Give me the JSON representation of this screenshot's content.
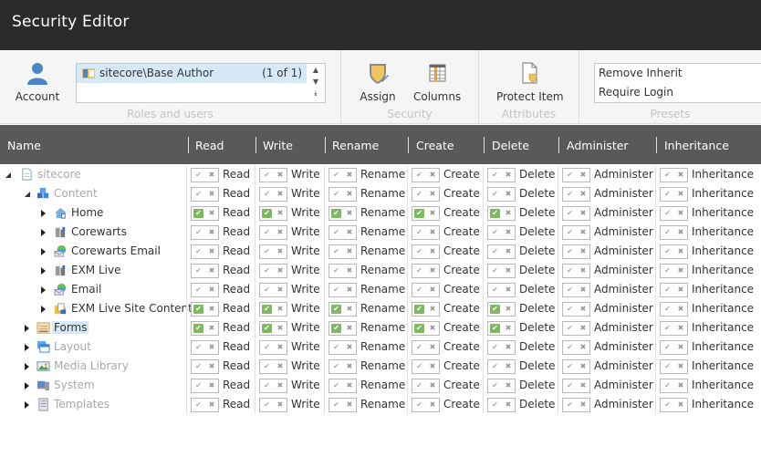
{
  "window": {
    "title": "Security Editor"
  },
  "ribbon": {
    "roles_group": {
      "label": "Roles and users",
      "account_button": "Account",
      "selected_role": "sitecore\\Base Author",
      "role_count": "(1 of 1)",
      "scroll_up": "▲",
      "scroll_down": "▼",
      "scroll_more": "⯯"
    },
    "security_group": {
      "label": "Security",
      "assign_button": "Assign",
      "columns_button": "Columns"
    },
    "attributes_group": {
      "label": "Attributes",
      "protect_button": "Protect Item"
    },
    "presets_group": {
      "label": "Presets",
      "items": [
        "Remove Inherit",
        "Require Login"
      ]
    }
  },
  "grid": {
    "columns": [
      "Name",
      "Read",
      "Write",
      "Rename",
      "Create",
      "Delete",
      "Administer",
      "Inheritance"
    ],
    "perm_labels": [
      "Read",
      "Write",
      "Rename",
      "Create",
      "Delete",
      "Administer",
      "Inheritance"
    ],
    "allow_glyph": "✔",
    "deny_glyph": "✖",
    "rows": [
      {
        "name": "sitecore",
        "icon": "document-icon",
        "level": 0,
        "state": "expanded",
        "style": "dim",
        "allow": [
          false,
          false,
          false,
          false,
          false,
          false,
          false
        ]
      },
      {
        "name": "Content",
        "icon": "content-cubes-icon",
        "level": 1,
        "state": "expanded",
        "style": "dim",
        "allow": [
          false,
          false,
          false,
          false,
          false,
          false,
          false
        ]
      },
      {
        "name": "Home",
        "icon": "home-icon",
        "level": 2,
        "state": "collapsed",
        "style": "norm",
        "allow": [
          true,
          true,
          true,
          true,
          true,
          false,
          false
        ]
      },
      {
        "name": "Corewarts",
        "icon": "server-icon",
        "level": 2,
        "state": "collapsed",
        "style": "norm",
        "allow": [
          false,
          false,
          false,
          false,
          false,
          false,
          false
        ]
      },
      {
        "name": "Corewarts Email",
        "icon": "email-globe-icon",
        "level": 2,
        "state": "collapsed",
        "style": "norm",
        "allow": [
          false,
          false,
          false,
          false,
          false,
          false,
          false
        ]
      },
      {
        "name": "EXM Live",
        "icon": "server-icon",
        "level": 2,
        "state": "collapsed",
        "style": "norm",
        "allow": [
          false,
          false,
          false,
          false,
          false,
          false,
          false
        ]
      },
      {
        "name": "Email",
        "icon": "email-globe-icon",
        "level": 2,
        "state": "collapsed",
        "style": "norm",
        "allow": [
          false,
          false,
          false,
          false,
          false,
          false,
          false
        ]
      },
      {
        "name": "EXM Live Site Content",
        "icon": "folder-site-icon",
        "level": 2,
        "state": "collapsed",
        "style": "norm",
        "allow": [
          true,
          true,
          true,
          true,
          true,
          false,
          false
        ]
      },
      {
        "name": "Forms",
        "icon": "forms-icon",
        "level": 1,
        "state": "collapsed",
        "style": "norm",
        "selected": true,
        "allow": [
          true,
          true,
          true,
          true,
          true,
          false,
          false
        ]
      },
      {
        "name": "Layout",
        "icon": "layout-icon",
        "level": 1,
        "state": "collapsed",
        "style": "dim",
        "allow": [
          false,
          false,
          false,
          false,
          false,
          false,
          false
        ]
      },
      {
        "name": "Media Library",
        "icon": "media-library-icon",
        "level": 1,
        "state": "collapsed",
        "style": "dim",
        "allow": [
          false,
          false,
          false,
          false,
          false,
          false,
          false
        ]
      },
      {
        "name": "System",
        "icon": "system-icon",
        "level": 1,
        "state": "collapsed",
        "style": "dim",
        "allow": [
          false,
          false,
          false,
          false,
          false,
          false,
          false
        ]
      },
      {
        "name": "Templates",
        "icon": "templates-icon",
        "level": 1,
        "state": "collapsed",
        "style": "dim",
        "allow": [
          false,
          false,
          false,
          false,
          false,
          false,
          false
        ]
      }
    ]
  },
  "colors": {
    "allow_on": "#7cb961",
    "header_bg": "#595959",
    "titlebar_bg": "#2b2b2b",
    "selection": "#d5e9f6"
  }
}
